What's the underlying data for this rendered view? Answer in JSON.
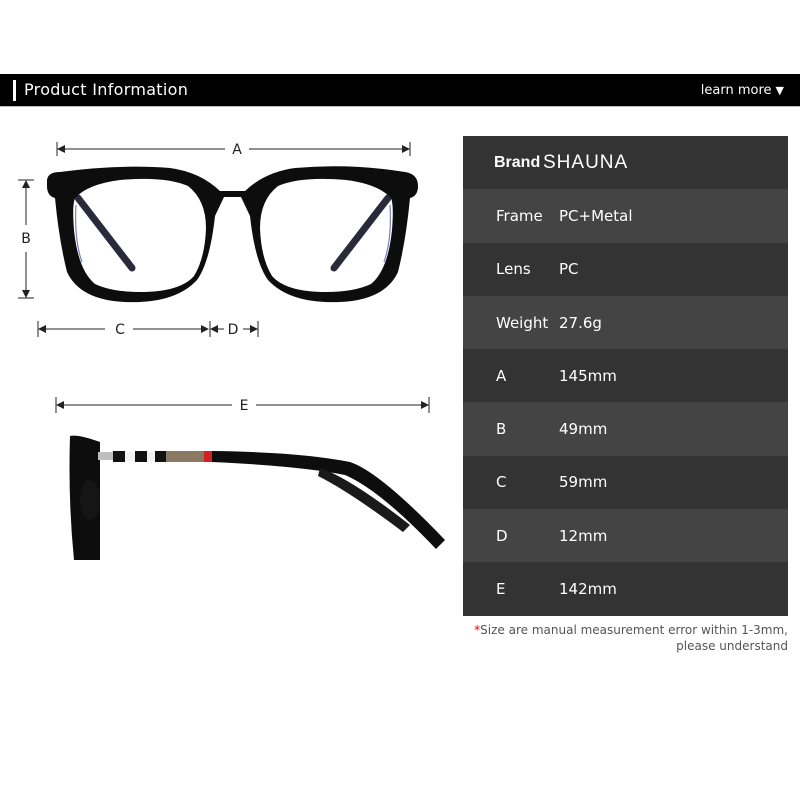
{
  "header": {
    "title": "Product Information",
    "learn_more": "learn more",
    "learn_more_icon": "triangle-down-icon",
    "learn_more_glyph": "▼"
  },
  "diagram": {
    "front_view": {
      "labels": {
        "A": "A",
        "B": "B",
        "C": "C",
        "D": "D"
      }
    },
    "side_view": {
      "labels": {
        "E": "E"
      }
    },
    "colors": {
      "frame": "#0d0d0d",
      "temple_accent_red": "#d42020",
      "temple_accent_tan": "#8a7a64"
    }
  },
  "specs": {
    "brand": {
      "label": "Brand",
      "value": "SHAUNA"
    },
    "rows": [
      {
        "label": "Frame",
        "value": "PC+Metal"
      },
      {
        "label": "Lens",
        "value": "PC"
      },
      {
        "label": "Weight",
        "value": "27.6g"
      },
      {
        "label": "A",
        "value": "145mm"
      },
      {
        "label": "B",
        "value": "49mm"
      },
      {
        "label": "C",
        "value": "59mm"
      },
      {
        "label": "D",
        "value": "12mm"
      },
      {
        "label": "E",
        "value": "142mm"
      }
    ],
    "colors": {
      "dark_row": "#333333",
      "light_row": "#444444"
    }
  },
  "note": {
    "star": "*",
    "line1": "Size are manual measurement error within 1-3mm,",
    "line2": "please understand"
  }
}
